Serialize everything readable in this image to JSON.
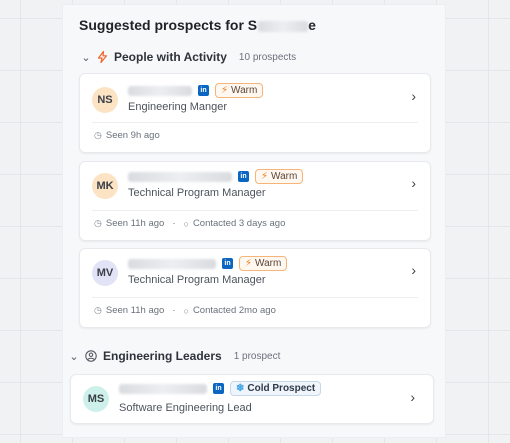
{
  "panel": {
    "title": "Suggested prospects for S"
  },
  "sections": [
    {
      "title": "People with Activity",
      "count": "10 prospects",
      "icon": "bolt-icon",
      "prospects": [
        {
          "initials": "NS",
          "avatar_color": "#fbe3c4",
          "role": "Engineering Manger",
          "badge": "Warm",
          "seen": "Seen 9h ago",
          "contacted": ""
        },
        {
          "initials": "MK",
          "avatar_color": "#fbe3c4",
          "role": "Technical Program Manager",
          "badge": "Warm",
          "seen": "Seen 11h ago",
          "contacted": "Contacted 3 days ago"
        },
        {
          "initials": "MV",
          "avatar_color": "#e2e3f7",
          "role": "Technical Program Manager",
          "badge": "Warm",
          "seen": "Seen 11h ago",
          "contacted": "Contacted 2mo ago"
        }
      ]
    },
    {
      "title": "Engineering Leaders",
      "count": "1 prospect",
      "icon": "user-circle-icon",
      "prospects": [
        {
          "initials": "MS",
          "avatar_color": "#cdf1ea",
          "role": "Software Engineering Lead",
          "badge": "Cold Prospect"
        }
      ]
    }
  ],
  "linkedin_label": "in",
  "separator": "·"
}
